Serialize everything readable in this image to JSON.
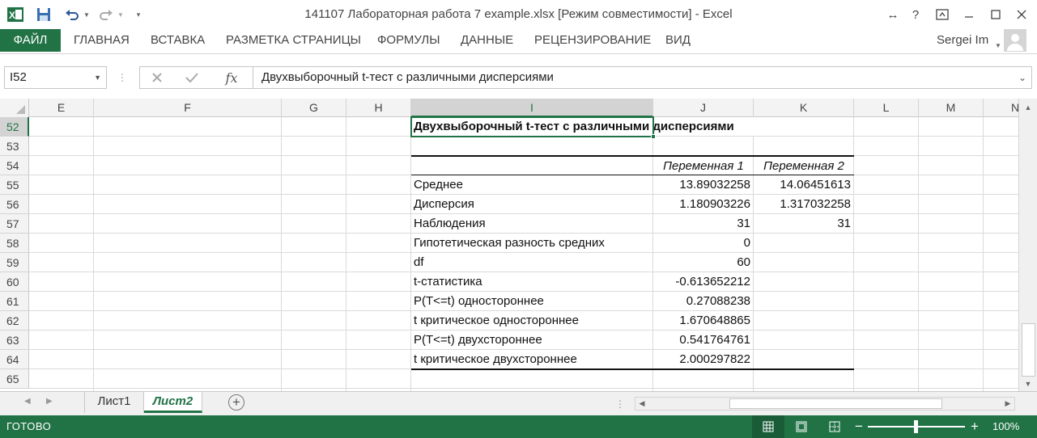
{
  "window": {
    "title": "141107 Лабораторная работа 7 example.xlsx  [Режим совместимости] - Excel",
    "user": "Sergei Im"
  },
  "ribbon": {
    "tabs": [
      "ФАЙЛ",
      "ГЛАВНАЯ",
      "ВСТАВКА",
      "РАЗМЕТКА СТРАНИЦЫ",
      "ФОРМУЛЫ",
      "ДАННЫЕ",
      "РЕЦЕНЗИРОВАНИЕ",
      "ВИД"
    ]
  },
  "formula_bar": {
    "name_box": "I52",
    "fx": "fx",
    "content": "Двухвыборочный t-тест с различными дисперсиями"
  },
  "grid": {
    "columns": [
      "E",
      "F",
      "G",
      "H",
      "I",
      "J",
      "K",
      "L",
      "M",
      "N"
    ],
    "selected_column": "I",
    "rows": [
      "52",
      "53",
      "54",
      "55",
      "56",
      "57",
      "58",
      "59",
      "60",
      "61",
      "62",
      "63",
      "64",
      "65"
    ],
    "selected_row": "52",
    "table": {
      "title": "Двухвыборочный t-тест с различными дисперсиями",
      "headers": [
        "Переменная 1",
        "Переменная 2"
      ],
      "rows": [
        {
          "label": "Среднее",
          "v1": "13.89032258",
          "v2": "14.06451613"
        },
        {
          "label": "Дисперсия",
          "v1": "1.180903226",
          "v2": "1.317032258"
        },
        {
          "label": "Наблюдения",
          "v1": "31",
          "v2": "31"
        },
        {
          "label": "Гипотетическая разность средних",
          "v1": "0",
          "v2": ""
        },
        {
          "label": "df",
          "v1": "60",
          "v2": ""
        },
        {
          "label": "t-статистика",
          "v1": "-0.613652212",
          "v2": ""
        },
        {
          "label": "P(T<=t) одностороннее",
          "v1": "0.27088238",
          "v2": ""
        },
        {
          "label": "t критическое одностороннее",
          "v1": "1.670648865",
          "v2": ""
        },
        {
          "label": "P(T<=t) двухстороннее",
          "v1": "0.541764761",
          "v2": ""
        },
        {
          "label": "t критическое двухстороннее",
          "v1": "2.000297822",
          "v2": ""
        }
      ]
    }
  },
  "sheets": {
    "tabs": [
      "Лист1",
      "Лист2"
    ],
    "active": "Лист2"
  },
  "status": {
    "mode": "ГОТОВО",
    "zoom": "100%"
  },
  "colors": {
    "accent": "#217346"
  }
}
